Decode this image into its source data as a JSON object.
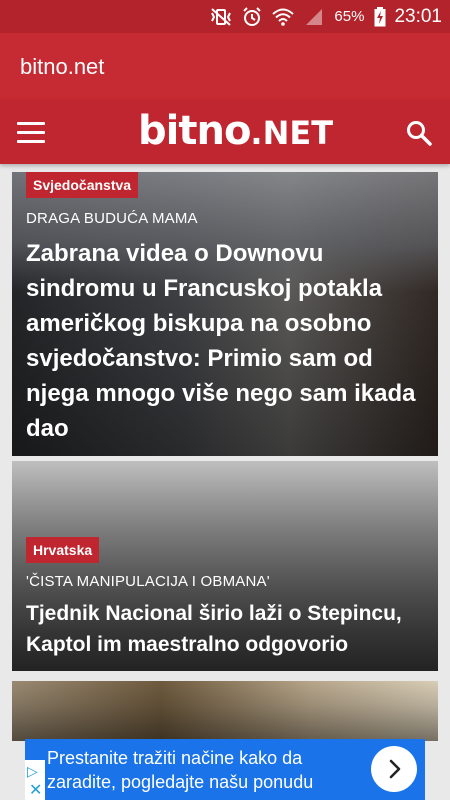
{
  "statusbar": {
    "battery": "65%",
    "time": "23:01",
    "icons": [
      "vibrate-off-icon",
      "alarm-icon",
      "wifi-icon",
      "signal-icon",
      "battery-charging-icon"
    ]
  },
  "titlebar": {
    "title": "bitno.net"
  },
  "navbar": {
    "logo_main": "bitno",
    "logo_tld": ".NET",
    "icons": [
      "menu-icon",
      "search-icon"
    ]
  },
  "articles": [
    {
      "category": "Svjedočanstva",
      "kicker": "DRAGA BUDUĆA MAMA",
      "headline": "Zabrana videa o Downovu sindromu u Francuskoj potakla američkog biskupa na osobno svjedočanstvo: Primio sam od njega mnogo više nego sam ikada dao"
    },
    {
      "category": "Hrvatska",
      "kicker": "'ČISTA MANIPULACIJA I OBMANA'",
      "headline": "Tjednik Nacional širio laži o Stepincu, Kaptol im maestralno odgovorio"
    }
  ],
  "ad": {
    "text": "Prestanite tražiti načine kako da zaradite, pogledajte našu ponudu",
    "cta_icon": "chevron-right-icon",
    "info_icon": "adchoices-icon",
    "close_icon": "close-icon"
  },
  "colors": {
    "brand_red": "#c0262f",
    "status_red": "#b3232b",
    "ad_blue": "#1a73e8"
  }
}
